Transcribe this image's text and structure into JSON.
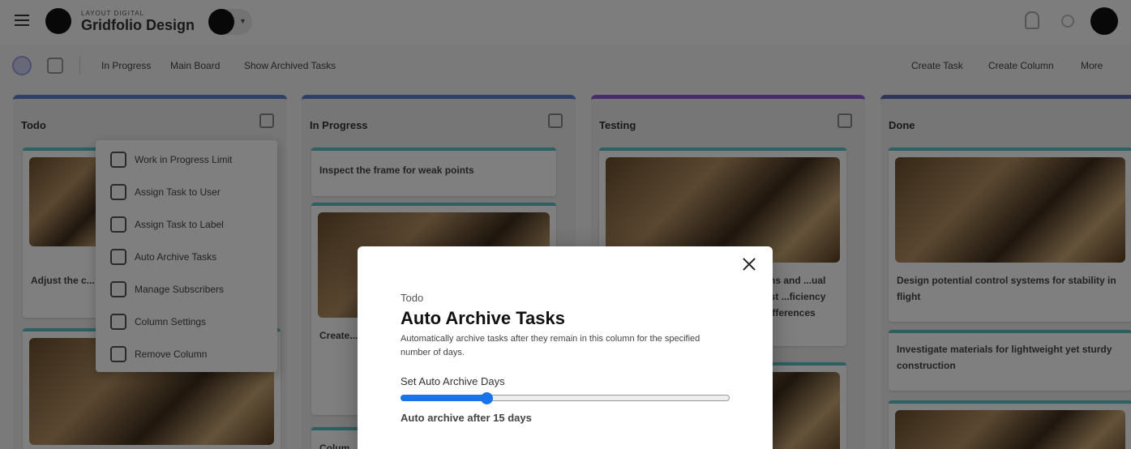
{
  "header": {
    "org_subtitle": "LAYOUT DIGITAL",
    "org_name": "Gridfolio Design"
  },
  "toolbar": {
    "in_progress": "In Progress",
    "main_board": "Main Board",
    "show_archived": "Show Archived Tasks",
    "create_task": "Create Task",
    "create_column": "Create Column",
    "more": "More"
  },
  "columns": [
    {
      "title": "Todo",
      "color": "#5c7ed1",
      "cards": [
        {
          "title": "Adjust the c..."
        },
        {
          "title": ""
        }
      ]
    },
    {
      "title": "In Progress",
      "color": "#5c7ed1",
      "cards": [
        {
          "title": "Inspect the frame for weak points"
        },
        {
          "title": "Create..."
        },
        {
          "title": "Colum..."
        }
      ]
    },
    {
      "title": "Testing",
      "color": "#8a5cd6",
      "cards": [
        {
          "title": "...ns and ...ual test ...ficiency ...ifferences"
        },
        {
          "title": ""
        }
      ]
    },
    {
      "title": "Done",
      "color": "#5d6bb0",
      "cards": [
        {
          "title": "Design potential control systems for stability in flight"
        },
        {
          "title": "Investigate materials for lightweight yet sturdy construction"
        },
        {
          "title": ""
        }
      ]
    }
  ],
  "menu": {
    "items": [
      {
        "label": "Work in Progress Limit"
      },
      {
        "label": "Assign Task to User"
      },
      {
        "label": "Assign Task to Label"
      },
      {
        "label": "Auto Archive Tasks"
      },
      {
        "label": "Manage Subscribers"
      },
      {
        "label": "Column Settings"
      },
      {
        "label": "Remove Column"
      }
    ]
  },
  "modal": {
    "subtitle": "Todo",
    "title": "Auto Archive Tasks",
    "description": "Automatically archive tasks after they remain in this column for the specified number of days.",
    "slider_label": "Set Auto Archive Days",
    "slider_fraction": 0.26,
    "value_text": "Auto archive after 15 days"
  }
}
